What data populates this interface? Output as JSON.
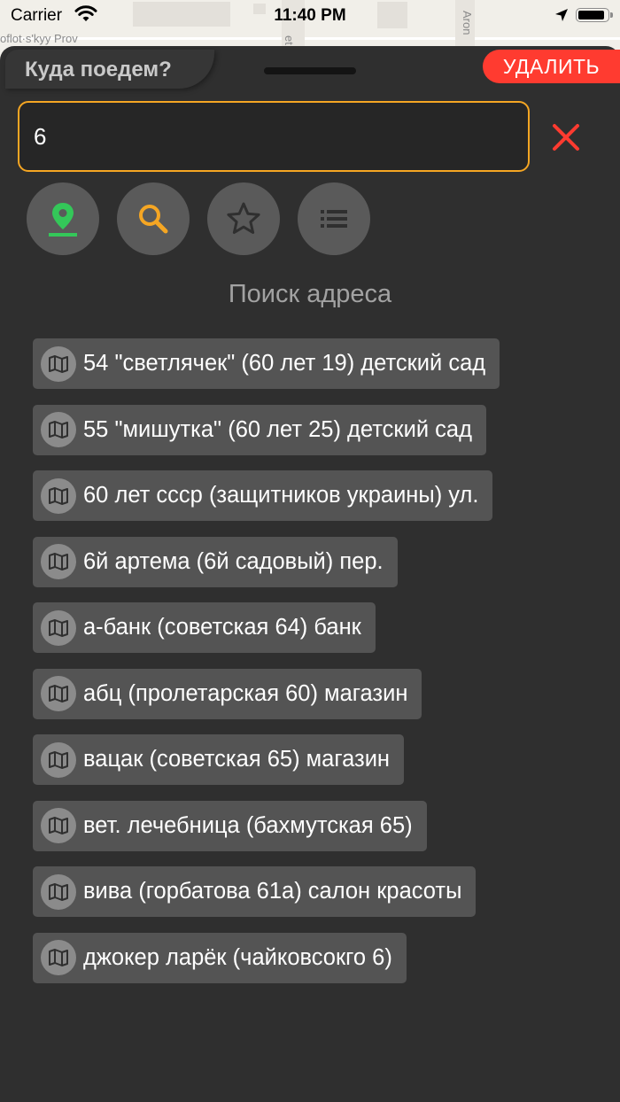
{
  "status_bar": {
    "carrier": "Carrier",
    "time": "11:40 PM",
    "battery_level": 0.95
  },
  "map": {
    "street_labels": [
      "oflot·s'kyy Prov",
      "et",
      "Aron"
    ]
  },
  "sheet": {
    "title": "Куда поедем?",
    "delete_label": "УДАЛИТЬ",
    "search": {
      "value": "6",
      "placeholder": ""
    },
    "modes": [
      {
        "name": "map-pin-icon",
        "color": "#34c759",
        "active": false
      },
      {
        "name": "search-icon",
        "color": "#f5a623",
        "active": true
      },
      {
        "name": "star-icon",
        "color": "#2f2f2f",
        "active": false
      },
      {
        "name": "list-icon",
        "color": "#2f2f2f",
        "active": false
      }
    ],
    "section_title": "Поиск адреса",
    "results": [
      "54 \"светлячек\" (60 лет 19) детский сад",
      "55 \"мишутка\" (60 лет 25) детский сад",
      "60 лет ссср (защитников украины) ул.",
      "6й артема (6й садовый) пер.",
      "а-банк (советская 64) банк",
      "абц (пролетарская 60) магазин",
      "вацак (советская 65) магазин",
      "вет. лечебница (бахмутская 65)",
      "вива (горбатова 61а) салон красоты",
      "джокер ларёк (чайковсокго 6)"
    ]
  },
  "colors": {
    "background": "#2f2f2f",
    "accent": "#f5a623",
    "danger": "#ff3b30",
    "item_background": "#545454"
  }
}
